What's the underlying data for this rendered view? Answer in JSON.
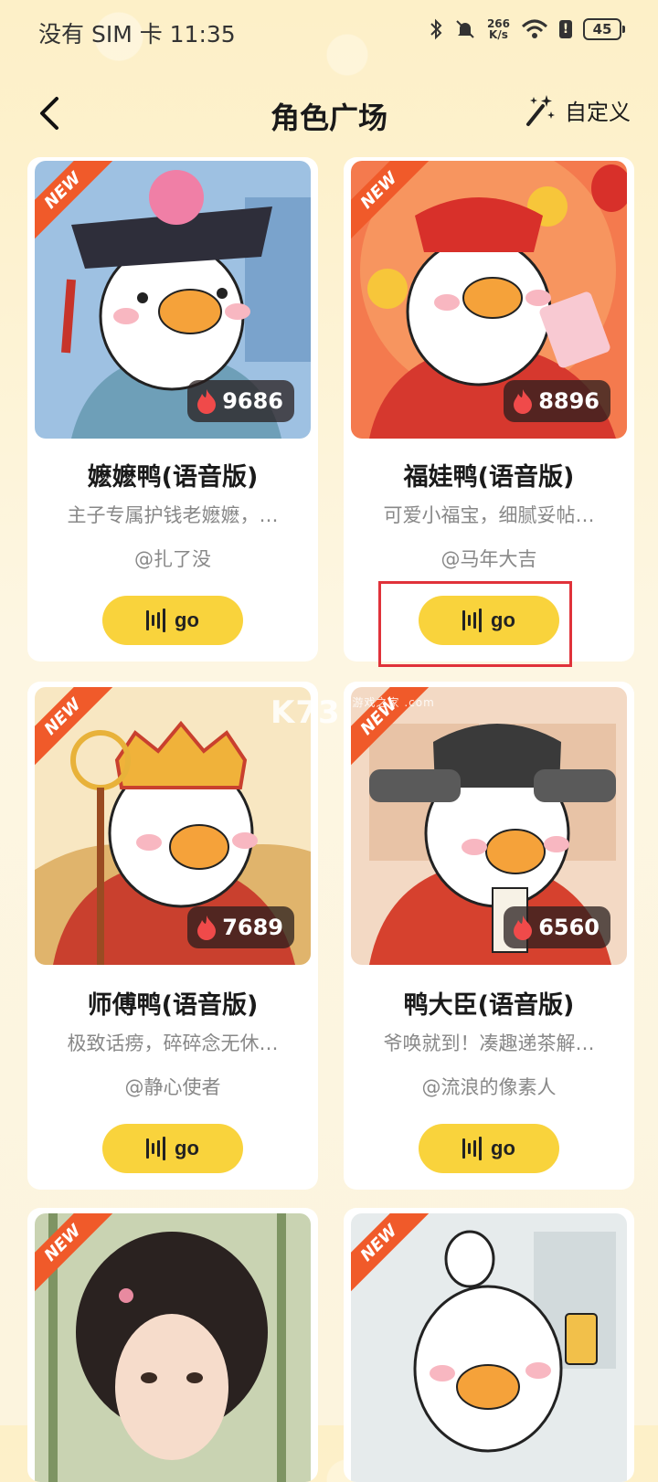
{
  "status_bar": {
    "carrier_time": "没有 SIM 卡 11:35",
    "net_speed_value": "266",
    "net_speed_unit": "K/s",
    "battery": "45"
  },
  "header": {
    "title": "角色广场",
    "custom_label": "自定义"
  },
  "cards": [
    {
      "name": "嬷嬷鸭(语音版)",
      "desc": "主子专属护钱老嬷嬷，…",
      "author": "@扎了没",
      "hot": "9686",
      "badge": "NEW",
      "go_label": "go",
      "bg_top": "#5D8FC4",
      "bg_bottom": "#B9D3EA"
    },
    {
      "name": "福娃鸭(语音版)",
      "desc": "可爱小福宝，细腻妥帖…",
      "author": "@马年大吉",
      "hot": "8896",
      "badge": "NEW",
      "go_label": "go",
      "bg_top": "#F5A060",
      "bg_bottom": "#E8553A"
    },
    {
      "name": "师傅鸭(语音版)",
      "desc": "极致话痨，碎碎念无休…",
      "author": "@静心使者",
      "hot": "7689",
      "badge": "NEW",
      "go_label": "go",
      "bg_top": "#F6E0B0",
      "bg_bottom": "#D9A860"
    },
    {
      "name": "鸭大臣(语音版)",
      "desc": "爷唤就到！凑趣递茶解…",
      "author": "@流浪的像素人",
      "hot": "6560",
      "badge": "NEW",
      "go_label": "go",
      "bg_top": "#F0C9B0",
      "bg_bottom": "#E26A4A"
    },
    {
      "badge": "NEW",
      "bg_top": "#9FB58C",
      "bg_bottom": "#DCE3C8"
    },
    {
      "badge": "NEW",
      "bg_top": "#C9D4D8",
      "bg_bottom": "#EEF1F2"
    }
  ],
  "watermark": "K73",
  "watermark_small": "游戏之家 .com"
}
